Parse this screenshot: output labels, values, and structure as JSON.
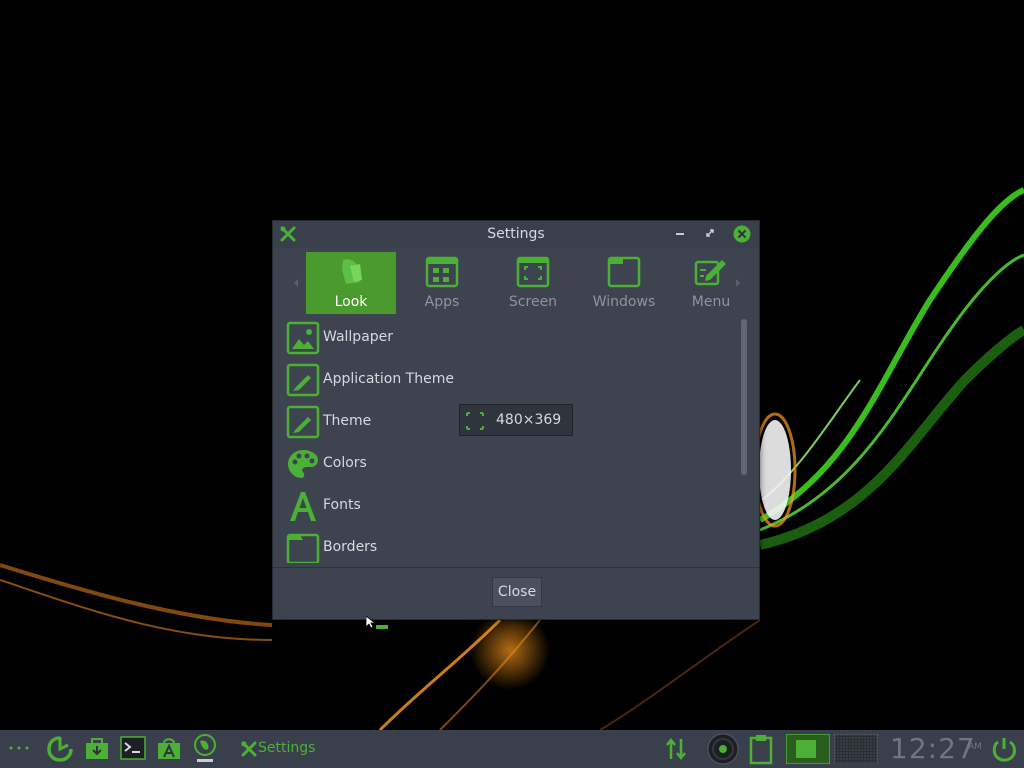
{
  "colors": {
    "accent": "#4caf36",
    "accent_active": "#4a9a2e",
    "window_bg": "#3d434f",
    "taskbar_bg": "#3a404b"
  },
  "window": {
    "title": "Settings",
    "title_icon": "tools-icon",
    "controls": [
      "minimize-icon",
      "maximize-icon",
      "close-icon"
    ],
    "tabs": [
      {
        "label": "Look",
        "icon": "look-icon",
        "active": true
      },
      {
        "label": "Apps",
        "icon": "apps-icon",
        "active": false
      },
      {
        "label": "Screen",
        "icon": "screen-icon",
        "active": false
      },
      {
        "label": "Windows",
        "icon": "windows-icon",
        "active": false
      },
      {
        "label": "Menu",
        "icon": "menu-edit-icon",
        "active": false
      }
    ],
    "items": [
      {
        "label": "Wallpaper",
        "icon": "wallpaper-icon"
      },
      {
        "label": "Application Theme",
        "icon": "brush-icon"
      },
      {
        "label": "Theme",
        "icon": "brush-icon"
      },
      {
        "label": "Colors",
        "icon": "palette-icon"
      },
      {
        "label": "Fonts",
        "icon": "font-icon"
      },
      {
        "label": "Borders",
        "icon": "folder-icon"
      }
    ],
    "tooltip": "480×369",
    "close_label": "Close"
  },
  "taskbar": {
    "task_label": "Settings",
    "clock": "12:27",
    "ampm": "AM",
    "icons": [
      "dots-icon",
      "power-swirl-icon",
      "package-icon",
      "terminal-icon",
      "app-store-icon",
      "install-icon",
      "network-arrows-icon",
      "disc-icon",
      "clipboard-icon",
      "desktop-1-icon",
      "desktop-2-icon",
      "power-icon"
    ]
  }
}
